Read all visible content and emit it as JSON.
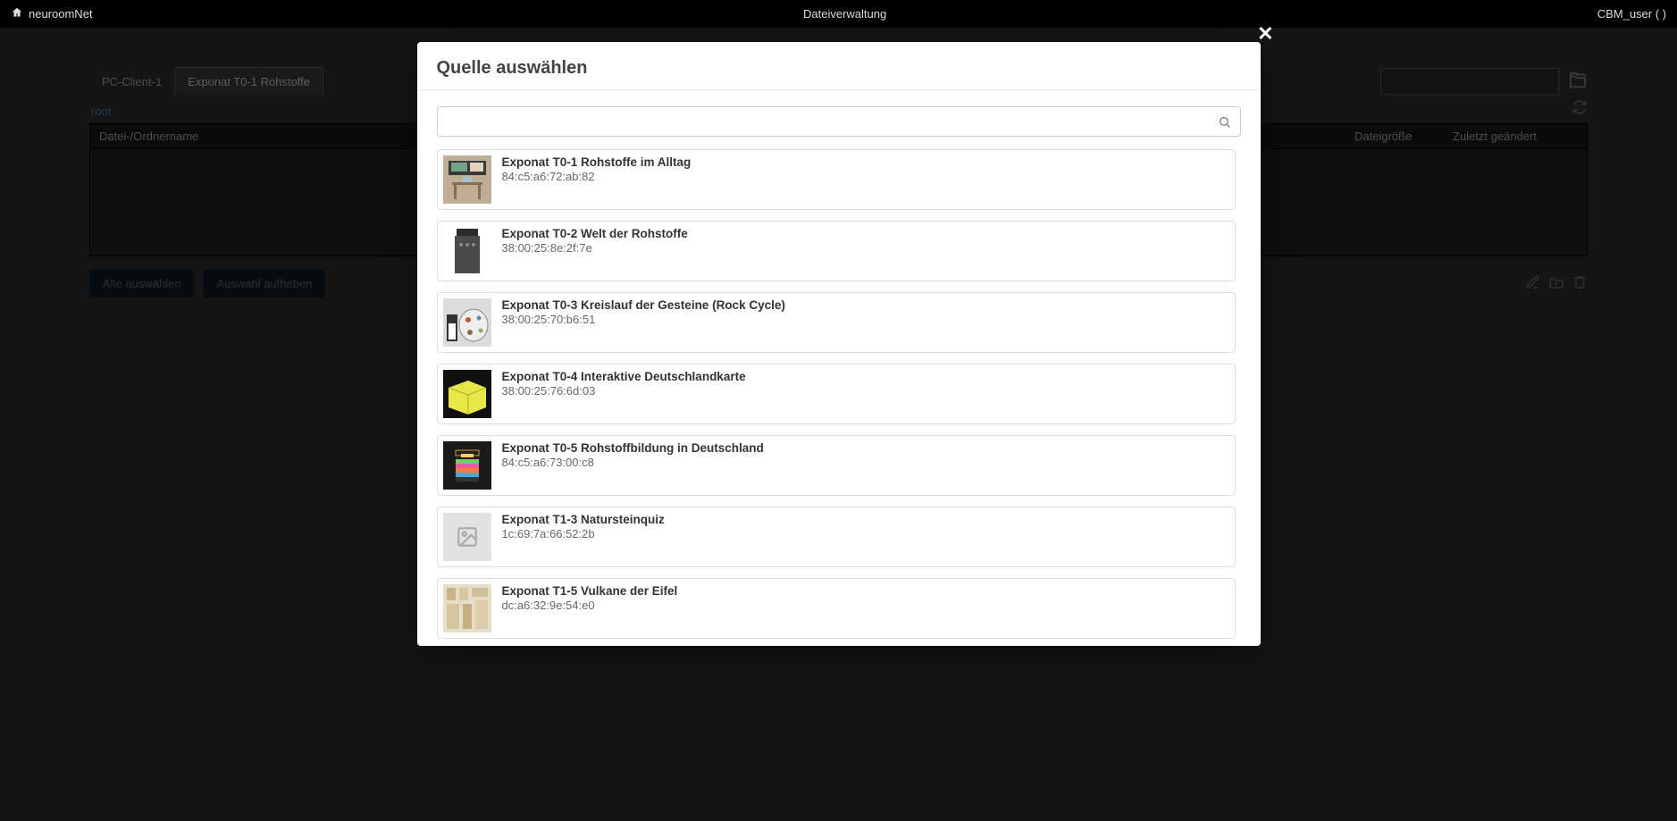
{
  "topbar": {
    "brand": "neuroomNet",
    "title": "Dateiverwaltung",
    "user": "CBM_user ( )"
  },
  "background": {
    "tab_client": "PC-Client-1",
    "tab_active": "Exponat T0-1 Rohstoffe",
    "breadcrumb": "root",
    "col_name": "Datei-/Ordnername",
    "col_size": "Dateigröße",
    "col_modified": "Zuletzt geändert",
    "btn_select_all": "Alle auswählen",
    "btn_clear_sel": "Auswahl aufheben"
  },
  "modal": {
    "title": "Quelle auswählen",
    "search_placeholder": ""
  },
  "sources": [
    {
      "title": "Exponat T0-1 Rohstoffe im Alltag",
      "mac": "84:c5:a6:72:ab:82",
      "thumb": "desk"
    },
    {
      "title": "Exponat T0-2 Welt der Rohstoffe",
      "mac": "38:00:25:8e:2f:7e",
      "thumb": "panel"
    },
    {
      "title": "Exponat T0-3 Kreislauf der Gesteine (Rock Cycle)",
      "mac": "38:00:25:70:b6:51",
      "thumb": "disc"
    },
    {
      "title": "Exponat T0-4 Interaktive Deutschlandkarte",
      "mac": "38:00:25:76:6d:03",
      "thumb": "yellow"
    },
    {
      "title": "Exponat T0-5 Rohstoffbildung in Deutschland",
      "mac": "84:c5:a6:73:00:c8",
      "thumb": "stack"
    },
    {
      "title": "Exponat T1-3 Natursteinquiz",
      "mac": "1c:69:7a:66:52:2b",
      "thumb": "placeholder"
    },
    {
      "title": "Exponat T1-5 Vulkane der Eifel",
      "mac": "dc:a6:32:9e:54:e0",
      "thumb": "collage"
    }
  ]
}
